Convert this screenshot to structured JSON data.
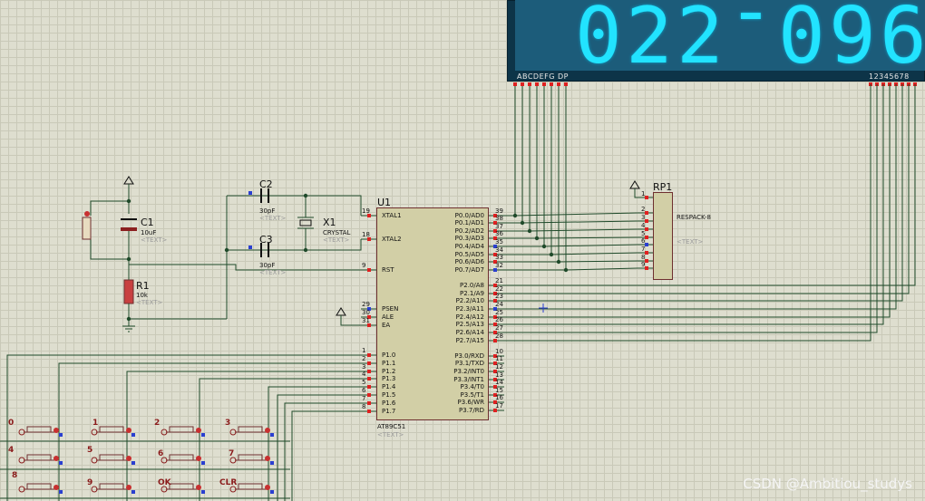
{
  "display": {
    "digits": [
      "0",
      "2",
      "2",
      "-",
      "0",
      "9",
      "6"
    ],
    "seg_label": "ABCDEFG  DP",
    "digit_label": "12345678"
  },
  "u1": {
    "name": "U1",
    "part": "AT89C51",
    "text": "<TEXT>",
    "left_pins": [
      {
        "num": "19",
        "label": "XTAL1"
      },
      {
        "num": "18",
        "label": "XTAL2"
      },
      {
        "num": "9",
        "label": "RST"
      },
      {
        "num": "29",
        "label": "PSEN"
      },
      {
        "num": "30",
        "label": "ALE"
      },
      {
        "num": "31",
        "label": "EA"
      },
      {
        "num": "1",
        "label": "P1.0"
      },
      {
        "num": "2",
        "label": "P1.1"
      },
      {
        "num": "3",
        "label": "P1.2"
      },
      {
        "num": "4",
        "label": "P1.3"
      },
      {
        "num": "5",
        "label": "P1.4"
      },
      {
        "num": "6",
        "label": "P1.5"
      },
      {
        "num": "7",
        "label": "P1.6"
      },
      {
        "num": "8",
        "label": "P1.7"
      }
    ],
    "right_pins": [
      {
        "num": "39",
        "label": "P0.0/AD0"
      },
      {
        "num": "38",
        "label": "P0.1/AD1"
      },
      {
        "num": "37",
        "label": "P0.2/AD2"
      },
      {
        "num": "36",
        "label": "P0.3/AD3"
      },
      {
        "num": "35",
        "label": "P0.4/AD4"
      },
      {
        "num": "34",
        "label": "P0.5/AD5"
      },
      {
        "num": "33",
        "label": "P0.6/AD6"
      },
      {
        "num": "32",
        "label": "P0.7/AD7"
      },
      {
        "num": "21",
        "label": "P2.0/A8"
      },
      {
        "num": "22",
        "label": "P2.1/A9"
      },
      {
        "num": "23",
        "label": "P2.2/A10"
      },
      {
        "num": "24",
        "label": "P2.3/A11"
      },
      {
        "num": "25",
        "label": "P2.4/A12"
      },
      {
        "num": "26",
        "label": "P2.5/A13"
      },
      {
        "num": "27",
        "label": "P2.6/A14"
      },
      {
        "num": "28",
        "label": "P2.7/A15"
      },
      {
        "num": "10",
        "label": "P3.0/RXD"
      },
      {
        "num": "11",
        "label": "P3.1/TXD"
      },
      {
        "num": "12",
        "label": "P3.2/INT0"
      },
      {
        "num": "13",
        "label": "P3.3/INT1"
      },
      {
        "num": "14",
        "label": "P3.4/T0"
      },
      {
        "num": "15",
        "label": "P3.5/T1"
      },
      {
        "num": "16",
        "label": "P3.6/WR"
      },
      {
        "num": "17",
        "label": "P3.7/RD"
      }
    ]
  },
  "rp1": {
    "name": "RP1",
    "part": "RESPACK-8",
    "text": "<TEXT>",
    "pins": [
      "1",
      "2",
      "3",
      "4",
      "5",
      "6",
      "7",
      "8",
      "9"
    ]
  },
  "c1": {
    "name": "C1",
    "value": "10uF",
    "text": "<TEXT>"
  },
  "r1": {
    "name": "R1",
    "value": "10k",
    "text": "<TEXT>"
  },
  "c2": {
    "name": "C2",
    "value": "30pF",
    "text": "<TEXT>"
  },
  "c3": {
    "name": "C3",
    "value": "30pF",
    "text": "<TEXT>"
  },
  "x1": {
    "name": "X1",
    "value": "CRYSTAL",
    "text": "<TEXT>"
  },
  "keys": [
    "0",
    "1",
    "2",
    "3",
    "4",
    "5",
    "6",
    "7",
    "8",
    "9",
    "OK",
    "CLR"
  ],
  "watermark": "CSDN @Ambitiou_studys"
}
